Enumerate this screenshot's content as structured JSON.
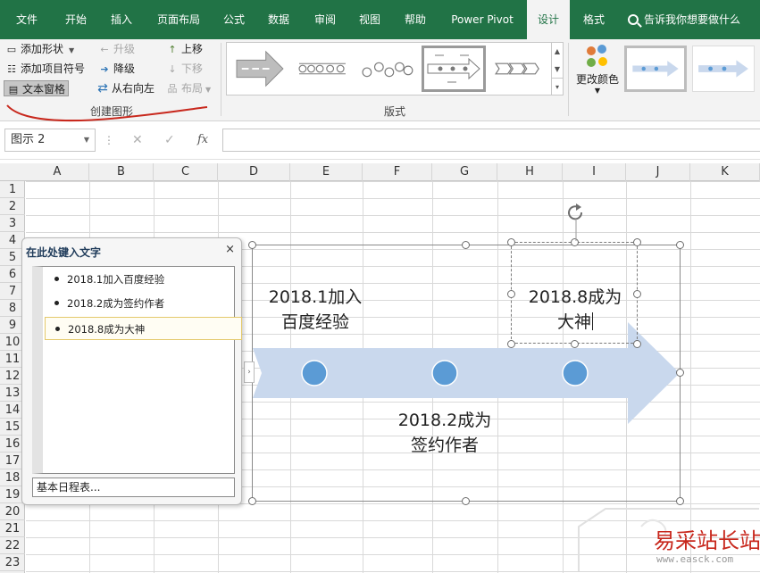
{
  "tabs": [
    {
      "label": "文件"
    },
    {
      "label": "开始"
    },
    {
      "label": "插入"
    },
    {
      "label": "页面布局"
    },
    {
      "label": "公式"
    },
    {
      "label": "数据"
    },
    {
      "label": "审阅"
    },
    {
      "label": "视图"
    },
    {
      "label": "帮助"
    },
    {
      "label": "Power Pivot"
    },
    {
      "label": "设计"
    },
    {
      "label": "格式"
    }
  ],
  "active_tab": "设计",
  "tell_me": "告诉我你想要做什么",
  "ribbon": {
    "create_graphic": {
      "add_shape": "添加形状",
      "add_bullet": "添加项目符号",
      "text_pane": "文本窗格",
      "promote": "升级",
      "demote": "降级",
      "right_to_left": "从右向左",
      "move_up": "上移",
      "move_down": "下移",
      "layout": "布局",
      "group_label": "创建图形"
    },
    "layouts": {
      "group_label": "版式"
    },
    "change_colors": "更改颜色"
  },
  "formula_bar": {
    "name_box": "图示 2",
    "fx": "fx",
    "formula": ""
  },
  "columns": [
    "A",
    "B",
    "C",
    "D",
    "E",
    "F",
    "G",
    "H",
    "I",
    "J",
    "K"
  ],
  "rows": [
    "1",
    "2",
    "3",
    "4",
    "5",
    "6",
    "7",
    "8",
    "9",
    "10",
    "11",
    "12",
    "13",
    "14",
    "15",
    "16",
    "17",
    "18",
    "19",
    "20",
    "21",
    "22",
    "23"
  ],
  "text_pane": {
    "title": "在此处键入文字",
    "close": "×",
    "items": [
      "2018.1加入百度经验",
      "2018.2成为签约作者",
      "2018.8成为大神"
    ],
    "footer": "基本日程表..."
  },
  "smartart": {
    "item1_line1": "2018.1加入",
    "item1_line2": "百度经验",
    "item2_line1": "2018.2成为",
    "item2_line2": "签约作者",
    "item3_line1": "2018.8成为",
    "item3_line2": "大神"
  },
  "watermark": {
    "text": "易采站长站",
    "url": "www.easck.com"
  },
  "colors": {
    "excel_green": "#217346",
    "arrow_fill": "#c9d8ed",
    "circle_fill": "#5b9bd5",
    "annotation_red": "#c8281d"
  }
}
